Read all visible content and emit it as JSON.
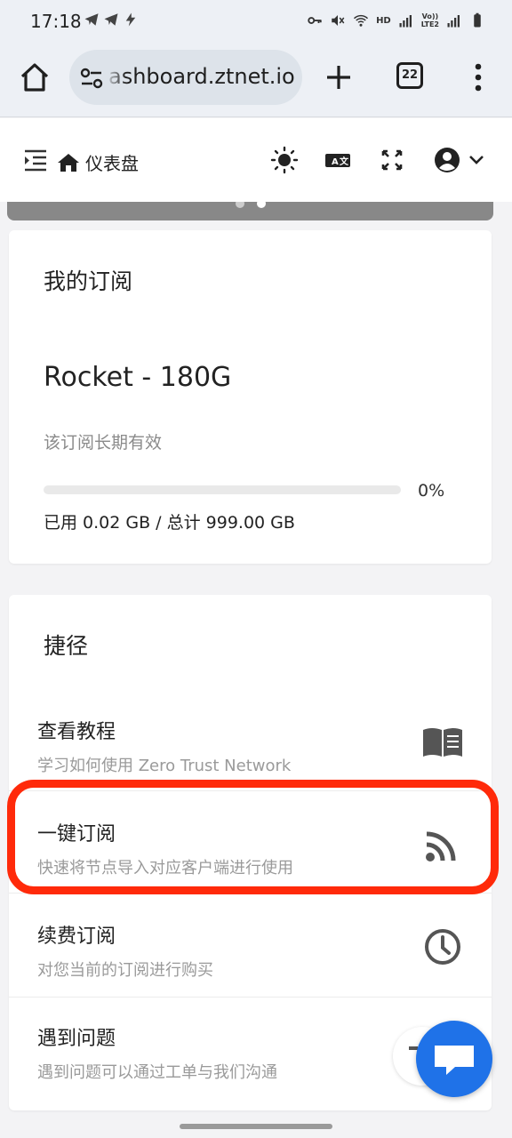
{
  "status": {
    "time": "17:18",
    "hd": "HD",
    "lte": "LTE2",
    "volte": "Vo))"
  },
  "browser": {
    "url": "ashboard.ztnet.io",
    "tab_count": "22"
  },
  "header": {
    "breadcrumb": "仪表盘"
  },
  "subscription": {
    "title": "我的订阅",
    "plan_name": "Rocket - 180G",
    "validity": "该订阅长期有效",
    "progress_fraction": 0.0,
    "progress_label": "0%",
    "usage": "已用 0.02 GB / 总计 999.00 GB"
  },
  "shortcuts": {
    "title": "捷径",
    "items": [
      {
        "title": "查看教程",
        "desc": "学习如何使用 Zero Trust Network",
        "icon": "book-icon"
      },
      {
        "title": "一键订阅",
        "desc": "快速将节点导入对应客户端进行使用",
        "icon": "rss-icon"
      },
      {
        "title": "续费订阅",
        "desc": "对您当前的订阅进行购买",
        "icon": "clock-icon"
      },
      {
        "title": "遇到问题",
        "desc": "遇到问题可以通过工单与我们沟通",
        "icon": "question-icon"
      }
    ]
  },
  "colors": {
    "highlight": "#ff2a0a",
    "chat_button": "#1f72e8",
    "progress_fill": "#5b7cf6"
  }
}
